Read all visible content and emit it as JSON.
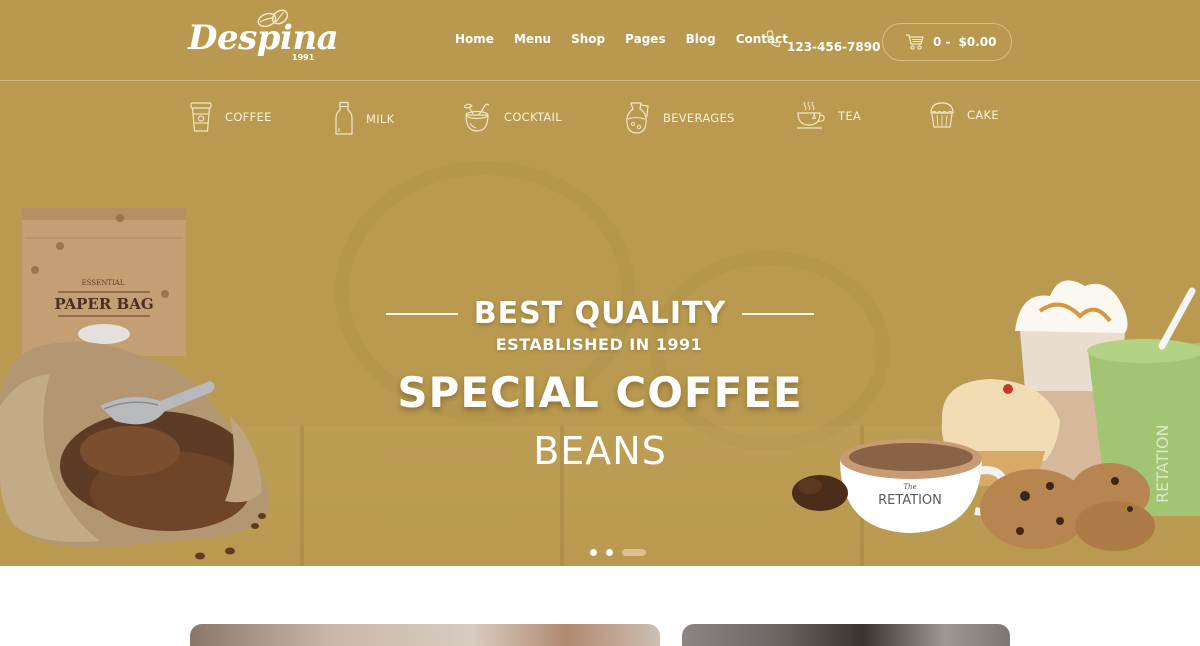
{
  "brand": {
    "name": "Despina",
    "year": "1991",
    "primary_color": "#b9994f",
    "text_color": "#ffffff"
  },
  "nav": {
    "items": [
      {
        "label": "Home"
      },
      {
        "label": "Menu"
      },
      {
        "label": "Shop"
      },
      {
        "label": "Pages"
      },
      {
        "label": "Blog"
      },
      {
        "label": "Contact"
      }
    ],
    "phone": {
      "icon": "phone-icon",
      "number": "123-456-7890"
    },
    "cart": {
      "icon": "cart-icon",
      "count": "0 -",
      "total": "$0.00"
    }
  },
  "categories": [
    {
      "label": "COFFEE",
      "icon": "coffee-cup-icon"
    },
    {
      "label": "MILK",
      "icon": "milk-bottle-icon"
    },
    {
      "label": "COCKTAIL",
      "icon": "coconut-cocktail-icon"
    },
    {
      "label": "BEVERAGES",
      "icon": "jug-icon"
    },
    {
      "label": "TEA",
      "icon": "tea-cup-icon"
    },
    {
      "label": "CAKE",
      "icon": "cupcake-icon"
    }
  ],
  "hero": {
    "kicker": "BEST QUALITY",
    "subtitle": "ESTABLISHED IN 1991",
    "title": "SPECIAL COFFEE",
    "title2": "BEANS",
    "left_image": {
      "alt": "Coffee beans sack with paper bag",
      "bag_label_top": "ESSENTIAL",
      "bag_label": "PAPER BAG"
    },
    "right_image": {
      "alt": "Cappuccino, muffin, milkshakes and cookies",
      "cup_brand_small": "The",
      "cup_brand": "RETATION"
    },
    "slider": {
      "slides": 3,
      "active": 3
    }
  },
  "cards": [
    {
      "alt": "Cafe interior with person"
    },
    {
      "alt": "Barista preparing drink"
    }
  ]
}
